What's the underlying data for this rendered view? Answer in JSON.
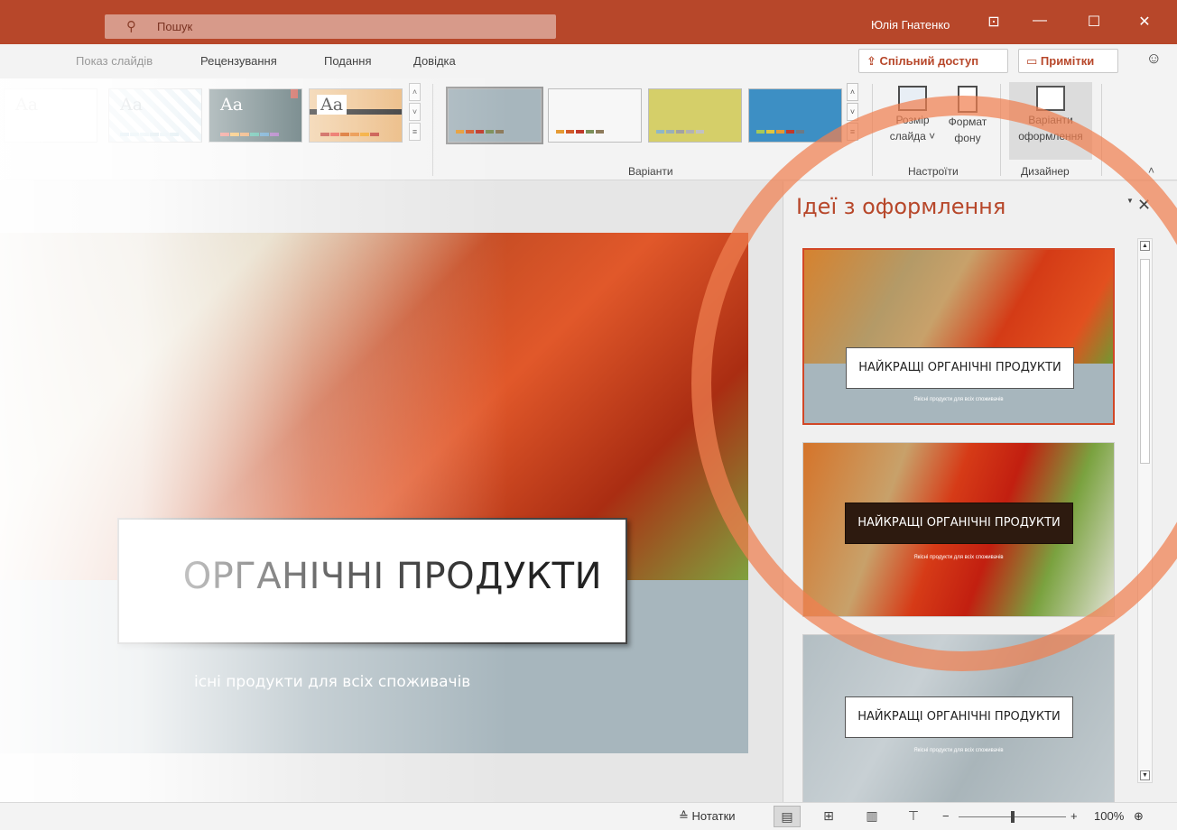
{
  "titlebar": {
    "search_placeholder": "Пошук",
    "user_name": "Юлія Гнатенко",
    "buttons": [
      "⊡",
      "—",
      "☐",
      "✕"
    ]
  },
  "ribbon": {
    "tabs": [
      "Показ слайдів",
      "Рецензування",
      "Подання",
      "Довідка"
    ],
    "share_label": "Спільний доступ",
    "comments_label": "Примітки",
    "theme_glyph": "Aa",
    "groups": {
      "variants": "Варіанти",
      "customize": "Настроїти",
      "designer": "Дизайнер"
    },
    "buttons": {
      "slide_size": [
        "Розмір",
        "слайда ˅"
      ],
      "format_background": [
        "Формат",
        "фону"
      ],
      "design_ideas": [
        "Варіанти",
        "оформлення"
      ]
    }
  },
  "slide": {
    "title": "НАЙКРАЩІ ОРГАНІЧНІ ПРОДУКТИ",
    "subtitle": "Якісні продукти для всіх споживачів",
    "visible_title": "ОРГАНІЧНІ ПРОДУКТИ",
    "visible_subtitle": "існі продукти для всіх споживачів"
  },
  "designer_pane": {
    "title": "Ідеї з оформлення",
    "ideas": [
      {
        "title": "НАЙКРАЩІ ОРГАНІЧНІ ПРОДУКТИ",
        "subtitle": "Якісні продукти для всіх споживачів",
        "style": "light box, grey band",
        "selected": true
      },
      {
        "title": "НАЙКРАЩІ ОРГАНІЧНІ ПРОДУКТИ",
        "subtitle": "Якісні продукти для всіх споживачів",
        "style": "dark box, full photo",
        "selected": false
      },
      {
        "title": "НАЙКРАЩІ ОРГАНІЧНІ ПРОДУКТИ",
        "subtitle": "Якісні продукти для всіх споживачів",
        "style": "grey washed photo",
        "selected": false
      }
    ]
  },
  "statusbar": {
    "notes_label": "Нотатки",
    "zoom_percent": "100%",
    "zoom_minus": "−",
    "zoom_plus": "+"
  },
  "colors": {
    "accent": "#b7472a",
    "annotation_circle": "#f08050",
    "slide_band": "#a7b6bd"
  }
}
